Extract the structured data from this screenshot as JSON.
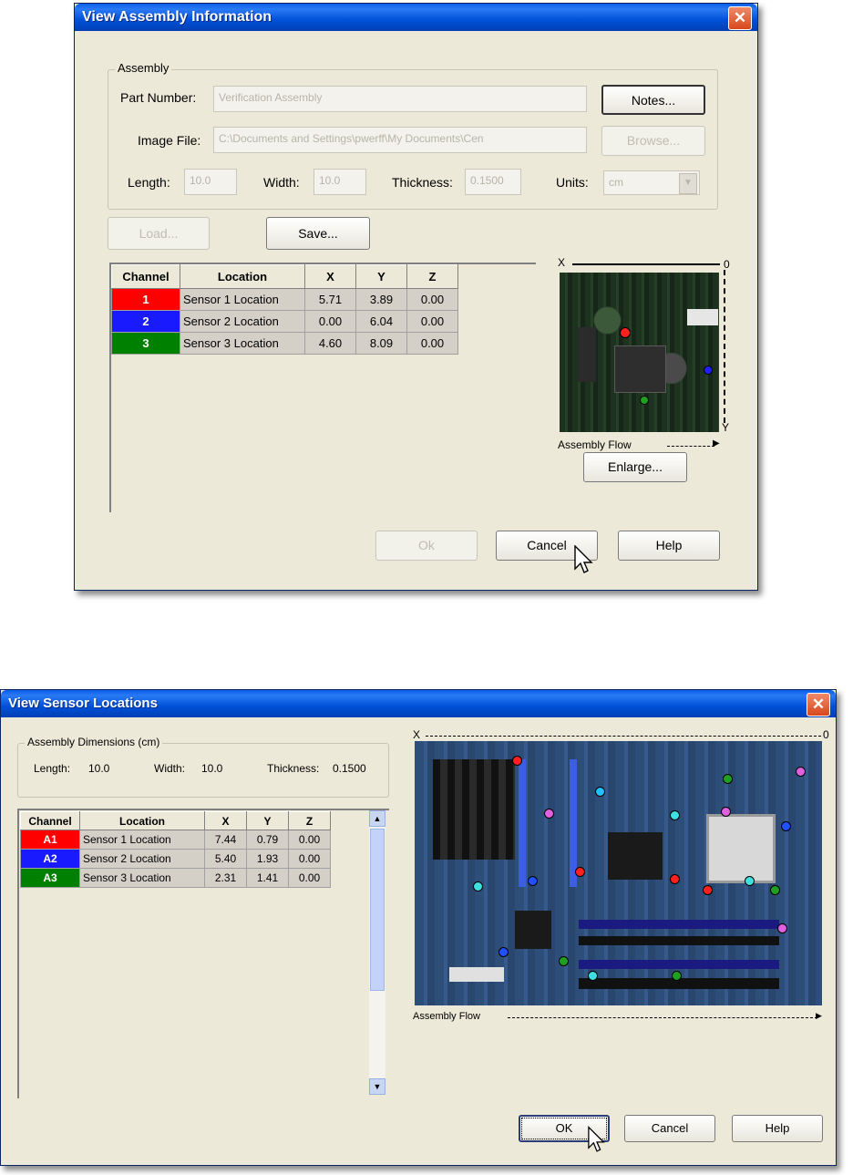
{
  "dialog1": {
    "title": "View Assembly Information",
    "assembly_group": "Assembly",
    "part_number_label": "Part Number:",
    "part_number_value": "Verification Assembly",
    "notes_button": "Notes...",
    "image_file_label": "Image File:",
    "image_file_value": "C:\\Documents and Settings\\pwerff\\My Documents\\Cen",
    "browse_button": "Browse...",
    "length_label": "Length:",
    "length_value": "10.0",
    "width_label": "Width:",
    "width_value": "10.0",
    "thickness_label": "Thickness:",
    "thickness_value": "0.1500",
    "units_label": "Units:",
    "units_value": "cm",
    "load_button": "Load...",
    "save_button": "Save...",
    "columns": [
      "Channel",
      "Location",
      "X",
      "Y",
      "Z"
    ],
    "rows": [
      {
        "channel": "1",
        "color": "#ff0000",
        "location": "Sensor 1 Location",
        "x": "5.71",
        "y": "3.89",
        "z": "0.00"
      },
      {
        "channel": "2",
        "color": "#1a1aff",
        "location": "Sensor 2 Location",
        "x": "0.00",
        "y": "6.04",
        "z": "0.00"
      },
      {
        "channel": "3",
        "color": "#008000",
        "location": "Sensor 3 Location",
        "x": "4.60",
        "y": "8.09",
        "z": "0.00"
      }
    ],
    "axis_x": "X",
    "axis_y": "Y",
    "axis_origin": "0",
    "assembly_flow": "Assembly Flow",
    "enlarge_button": "Enlarge...",
    "ok_button": "Ok",
    "cancel_button": "Cancel",
    "help_button": "Help"
  },
  "dialog2": {
    "title": "View Sensor Locations",
    "dimensions_group": "Assembly Dimensions (cm)",
    "length_label": "Length:",
    "length_value": "10.0",
    "width_label": "Width:",
    "width_value": "10.0",
    "thickness_label": "Thickness:",
    "thickness_value": "0.1500",
    "columns": [
      "Channel",
      "Location",
      "X",
      "Y",
      "Z"
    ],
    "rows": [
      {
        "channel": "A1",
        "color": "#ff0000",
        "location": "Sensor 1 Location",
        "x": "7.44",
        "y": "0.79",
        "z": "0.00"
      },
      {
        "channel": "A2",
        "color": "#1a1aff",
        "location": "Sensor 2 Location",
        "x": "5.40",
        "y": "1.93",
        "z": "0.00"
      },
      {
        "channel": "A3",
        "color": "#008000",
        "location": "Sensor 3 Location",
        "x": "2.31",
        "y": "1.41",
        "z": "0.00"
      }
    ],
    "axis_x": "X",
    "axis_origin": "0",
    "assembly_flow": "Assembly Flow",
    "ok_button": "OK",
    "cancel_button": "Cancel",
    "help_button": "Help"
  }
}
